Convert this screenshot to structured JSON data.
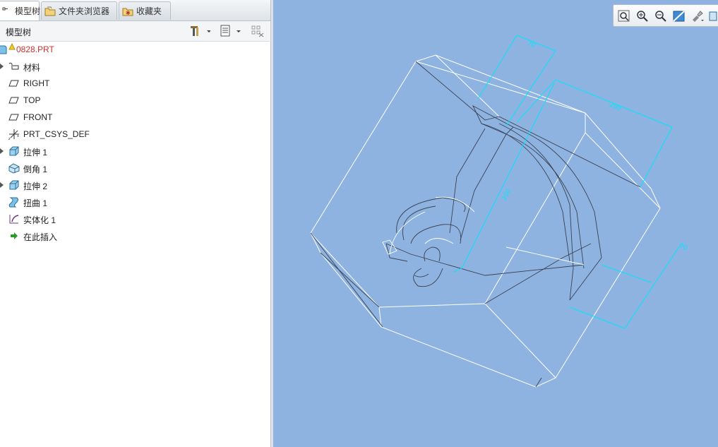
{
  "tabs": [
    {
      "label": "模型树",
      "icon": "model-tree-icon",
      "active": true
    },
    {
      "label": "文件夹浏览器",
      "icon": "folder-browser-icon",
      "active": false
    },
    {
      "label": "收藏夹",
      "icon": "favorites-icon",
      "active": false
    }
  ],
  "tree_header": {
    "title": "模型树",
    "tools": [
      "settings-tools-icon",
      "show-options-icon",
      "filter-columns-icon"
    ]
  },
  "tree": {
    "root": {
      "label": "0828.PRT",
      "warning": true,
      "color": "#d03030"
    },
    "items": [
      {
        "label": "材料",
        "icon": "material-icon",
        "expandable": true
      },
      {
        "label": "RIGHT",
        "icon": "datum-plane-icon",
        "expandable": false
      },
      {
        "label": "TOP",
        "icon": "datum-plane-icon",
        "expandable": false
      },
      {
        "label": "FRONT",
        "icon": "datum-plane-icon",
        "expandable": false
      },
      {
        "label": "PRT_CSYS_DEF",
        "icon": "coordinate-system-icon",
        "expandable": false
      },
      {
        "label": "拉伸 1",
        "icon": "extrude-icon",
        "expandable": true
      },
      {
        "label": "倒角 1",
        "icon": "chamfer-icon",
        "expandable": false
      },
      {
        "label": "拉伸 2",
        "icon": "extrude-icon",
        "expandable": true
      },
      {
        "label": "扭曲 1",
        "icon": "warp-icon",
        "expandable": false
      },
      {
        "label": "实体化 1",
        "icon": "solidify-icon",
        "expandable": false
      },
      {
        "label": "在此插入",
        "icon": "insert-here-arrow-icon",
        "expandable": false
      }
    ]
  },
  "view_toolbar": [
    "refit-icon",
    "zoom-in-icon",
    "zoom-out-icon",
    "repaint-icon",
    "saved-views-icon",
    "display-style-icon"
  ],
  "dimensions": [
    "70",
    "200",
    "200",
    "70"
  ],
  "colors": {
    "viewport_bg": "#8fb3e1",
    "edge": "#ffffff",
    "dim": "#00e5ff",
    "root_text": "#d03030"
  }
}
